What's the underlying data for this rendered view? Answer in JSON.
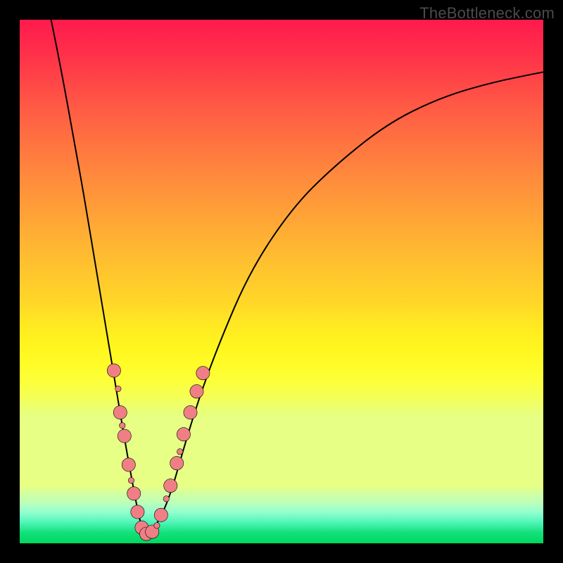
{
  "watermark": "TheBottleneck.com",
  "colors": {
    "frame": "#000000",
    "curve": "#000000",
    "dot_fill": "#ef7f85",
    "gradient_top": "#ff1a4d",
    "gradient_mid": "#fff41e",
    "gradient_bot": "#00d85e"
  },
  "chart_data": {
    "type": "line",
    "title": "",
    "xlabel": "",
    "ylabel": "",
    "xlim": [
      0,
      100
    ],
    "ylim": [
      0,
      100
    ],
    "grid": false,
    "legend": false,
    "note": "Axes have no tick labels in the image; x and y are normalized 0–100. The curve is a V-shaped bottleneck valley with minimum near x≈24, y≈0.",
    "series": [
      {
        "name": "bottleneck-curve",
        "x": [
          6,
          8,
          10,
          12,
          14,
          16,
          18,
          20,
          22,
          23,
          24,
          25,
          27,
          29,
          31,
          34,
          38,
          44,
          52,
          60,
          70,
          80,
          90,
          100
        ],
        "y": [
          100,
          90,
          79,
          68,
          56,
          44,
          32,
          20,
          9,
          4,
          1.8,
          2,
          5,
          10,
          17,
          27,
          38,
          52,
          64,
          72,
          80,
          85,
          88,
          90
        ]
      }
    ],
    "markers": {
      "name": "highlight-dots",
      "note": "Pink dots clustered around the valley on both arms; large dots sit on the visible dashed segments, small dots faintly visible between.",
      "points": [
        {
          "x": 18.0,
          "y": 33.0,
          "size": "big"
        },
        {
          "x": 18.8,
          "y": 29.5,
          "size": "sm"
        },
        {
          "x": 19.2,
          "y": 25.0,
          "size": "big"
        },
        {
          "x": 19.6,
          "y": 22.5,
          "size": "sm"
        },
        {
          "x": 20.0,
          "y": 20.5,
          "size": "big"
        },
        {
          "x": 20.8,
          "y": 15.0,
          "size": "big"
        },
        {
          "x": 21.3,
          "y": 12.0,
          "size": "sm"
        },
        {
          "x": 21.8,
          "y": 9.5,
          "size": "big"
        },
        {
          "x": 22.5,
          "y": 6.0,
          "size": "big"
        },
        {
          "x": 23.3,
          "y": 3.0,
          "size": "big"
        },
        {
          "x": 24.2,
          "y": 1.8,
          "size": "big"
        },
        {
          "x": 25.3,
          "y": 2.2,
          "size": "big"
        },
        {
          "x": 26.2,
          "y": 3.4,
          "size": "sm"
        },
        {
          "x": 27.0,
          "y": 5.4,
          "size": "big"
        },
        {
          "x": 28.0,
          "y": 8.5,
          "size": "sm"
        },
        {
          "x": 28.8,
          "y": 11.0,
          "size": "big"
        },
        {
          "x": 30.0,
          "y": 15.3,
          "size": "big"
        },
        {
          "x": 30.6,
          "y": 17.5,
          "size": "sm"
        },
        {
          "x": 31.3,
          "y": 20.8,
          "size": "big"
        },
        {
          "x": 32.6,
          "y": 25.0,
          "size": "big"
        },
        {
          "x": 33.8,
          "y": 29.0,
          "size": "big"
        },
        {
          "x": 35.0,
          "y": 32.5,
          "size": "big"
        }
      ]
    }
  }
}
